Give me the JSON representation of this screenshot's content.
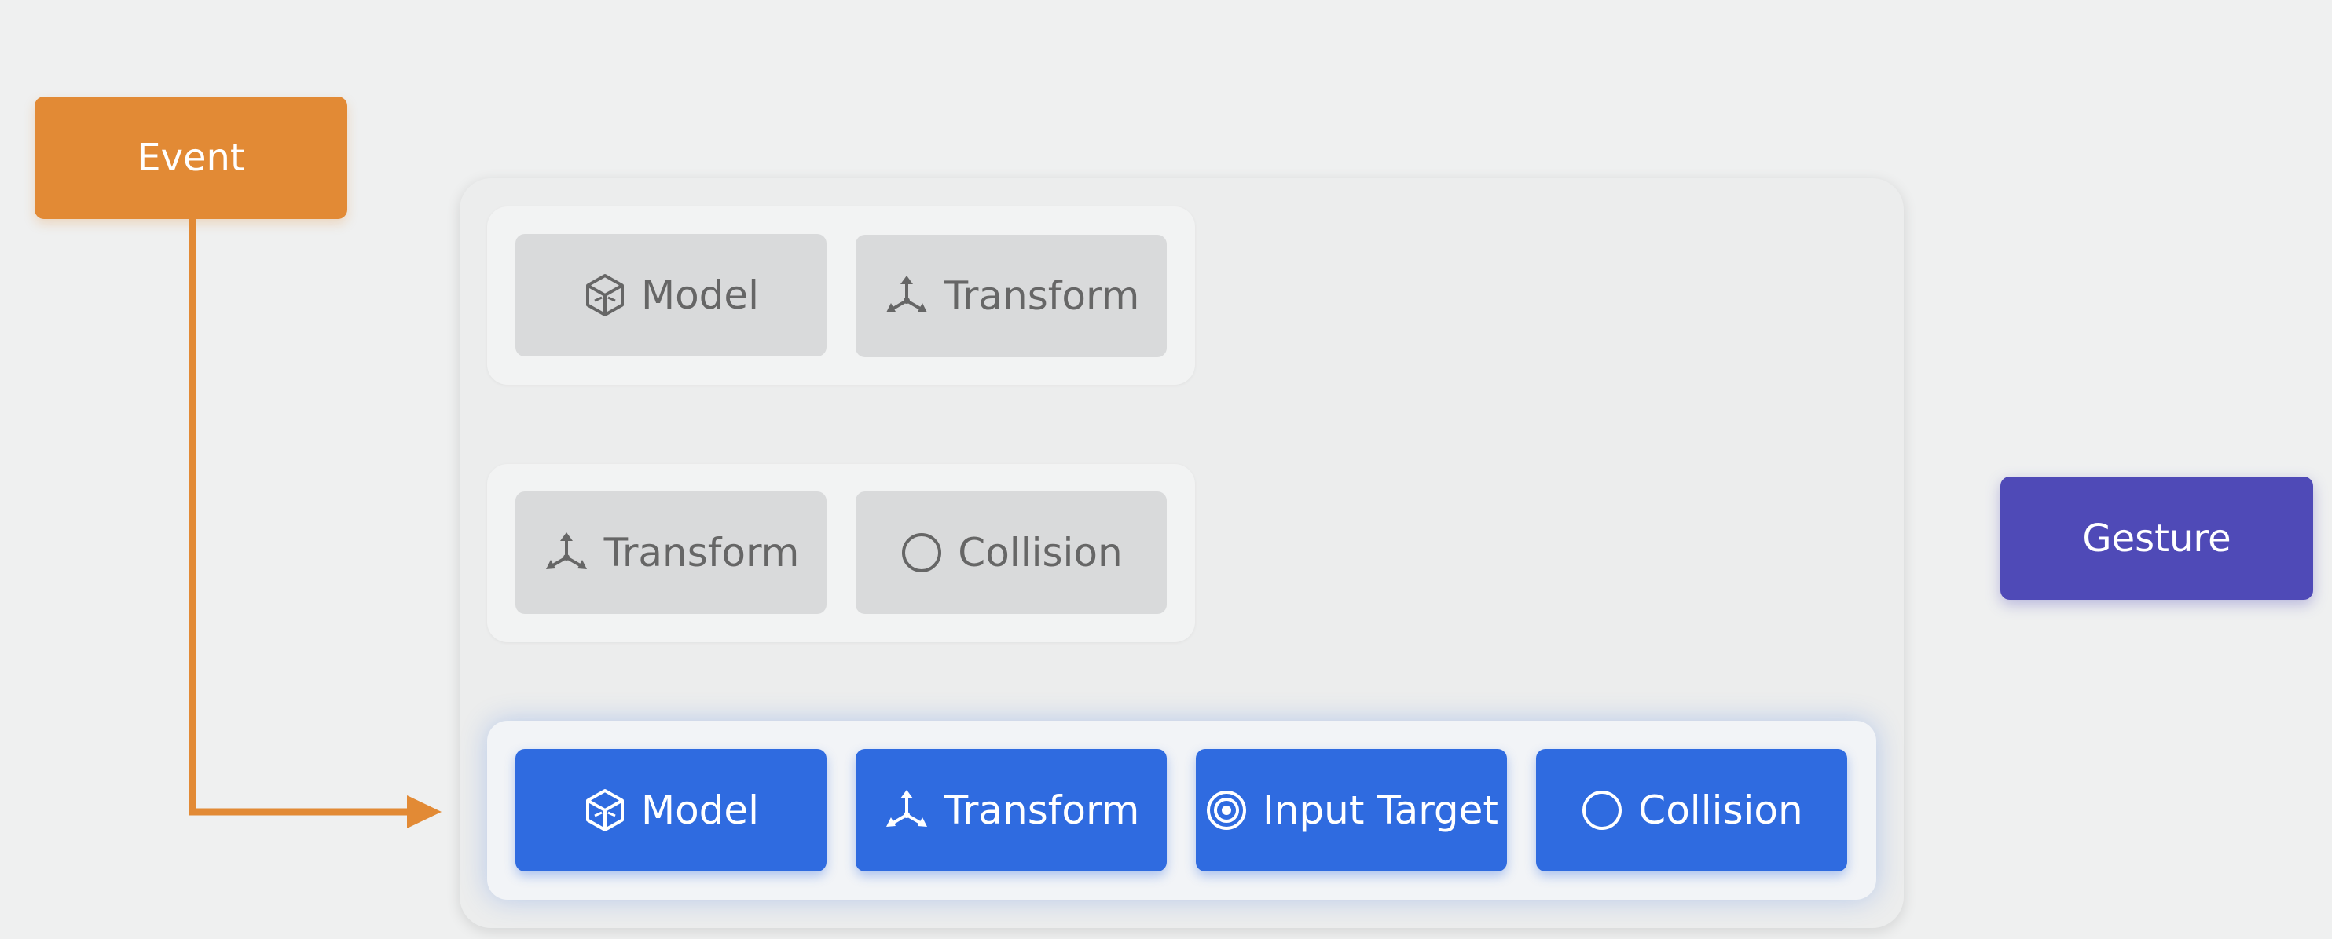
{
  "nodes": {
    "event": "Event",
    "gesture": "Gesture"
  },
  "colors": {
    "event": "#e28a35",
    "gesture": "#4f4ab7",
    "active_chip": "#2f6be0",
    "inactive_chip": "#d9dadb",
    "inactive_text": "#666666"
  },
  "entities": [
    {
      "state": "inactive",
      "components": [
        {
          "label": "Model",
          "icon": "cube-icon"
        },
        {
          "label": "Transform",
          "icon": "transform-axes-icon"
        }
      ]
    },
    {
      "state": "inactive",
      "components": [
        {
          "label": "Transform",
          "icon": "transform-axes-icon"
        },
        {
          "label": "Collision",
          "icon": "circle-icon"
        }
      ]
    },
    {
      "state": "active",
      "components": [
        {
          "label": "Model",
          "icon": "cube-icon"
        },
        {
          "label": "Transform",
          "icon": "transform-axes-icon"
        },
        {
          "label": "Input Target",
          "icon": "target-icon"
        },
        {
          "label": "Collision",
          "icon": "circle-icon"
        }
      ]
    }
  ]
}
